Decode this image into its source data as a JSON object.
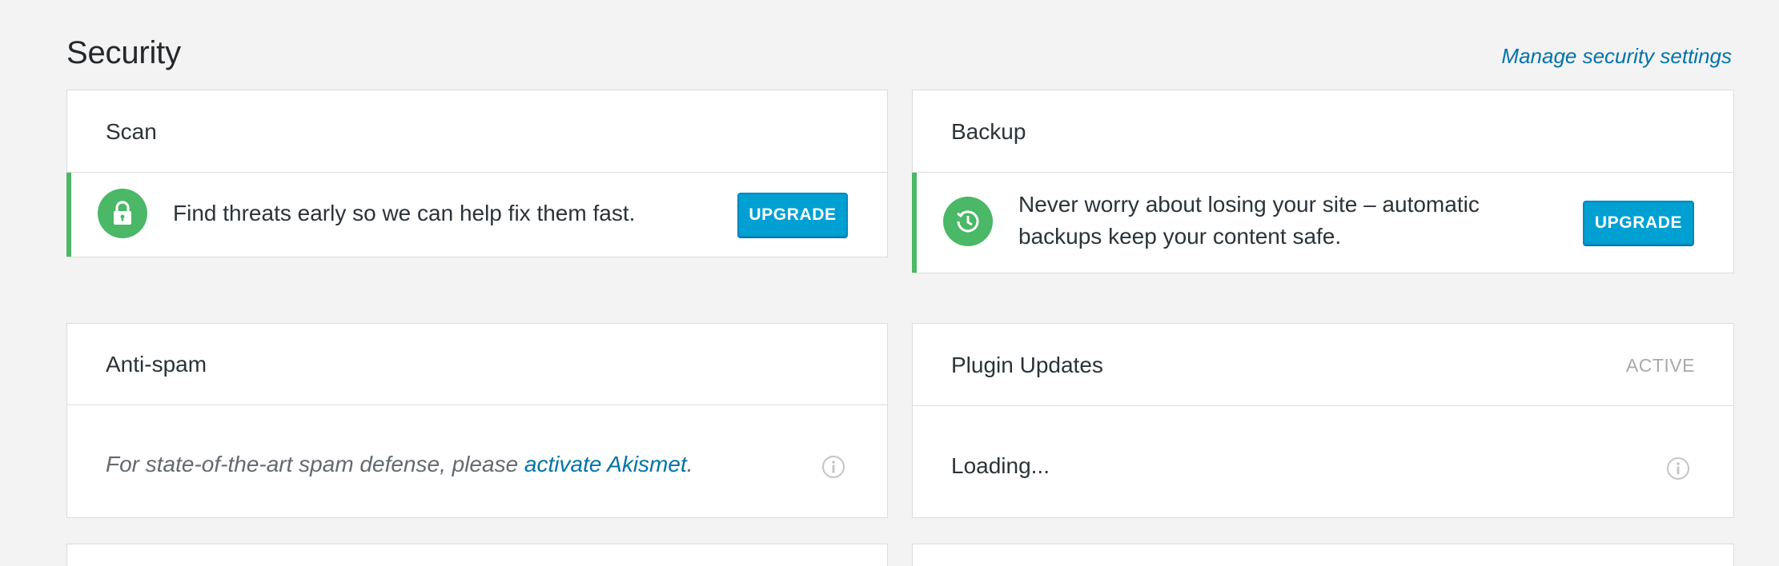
{
  "header": {
    "title": "Security",
    "manage_link": "Manage security settings"
  },
  "cards": {
    "scan": {
      "title": "Scan",
      "message": "Find threats early so we can help fix them fast.",
      "button": "UPGRADE",
      "icon": "lock-icon"
    },
    "backup": {
      "title": "Backup",
      "message_line1": "Never worry about losing your site – automatic",
      "message_line2": "backups keep your content safe.",
      "button": "UPGRADE",
      "icon": "history-icon"
    },
    "antispam": {
      "title": "Anti-spam",
      "message_prefix": "For state-of-the-art spam defense, please ",
      "message_link": "activate Akismet",
      "message_suffix": "."
    },
    "plugin_updates": {
      "title": "Plugin Updates",
      "status": "ACTIVE",
      "message": "Loading..."
    }
  },
  "colors": {
    "accent_green": "#4ab866",
    "link_blue": "#0073aa",
    "button_blue": "#00a0d2"
  }
}
